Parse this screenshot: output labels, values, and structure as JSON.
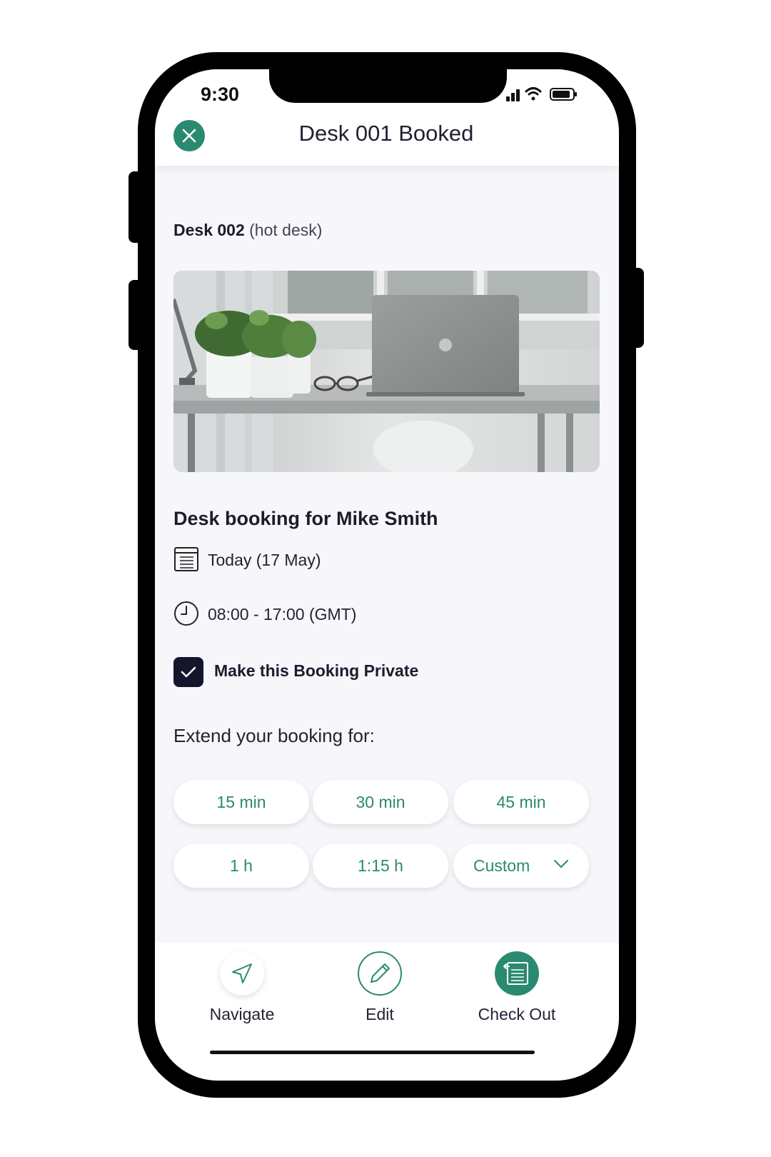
{
  "status_bar": {
    "time": "9:30"
  },
  "header": {
    "title": "Desk 001 Booked",
    "close_icon": "close-icon"
  },
  "desk": {
    "name": "Desk 002",
    "type": "(hot desk)"
  },
  "booking": {
    "title": "Desk booking for Mike Smith",
    "date": "Today (17 May)",
    "time": "08:00 - 17:00 (GMT)",
    "private_label": "Make this Booking Private",
    "private_checked": true
  },
  "extend": {
    "label": "Extend your booking for:",
    "options": [
      "15 min",
      "30 min",
      "45 min",
      "1 h",
      "1:15 h"
    ],
    "custom_label": "Custom"
  },
  "actions": {
    "navigate": "Navigate",
    "edit": "Edit",
    "check_out": "Check Out"
  },
  "colors": {
    "accent": "#2a8a70",
    "dark": "#15152b",
    "background": "#f7f7fb"
  }
}
